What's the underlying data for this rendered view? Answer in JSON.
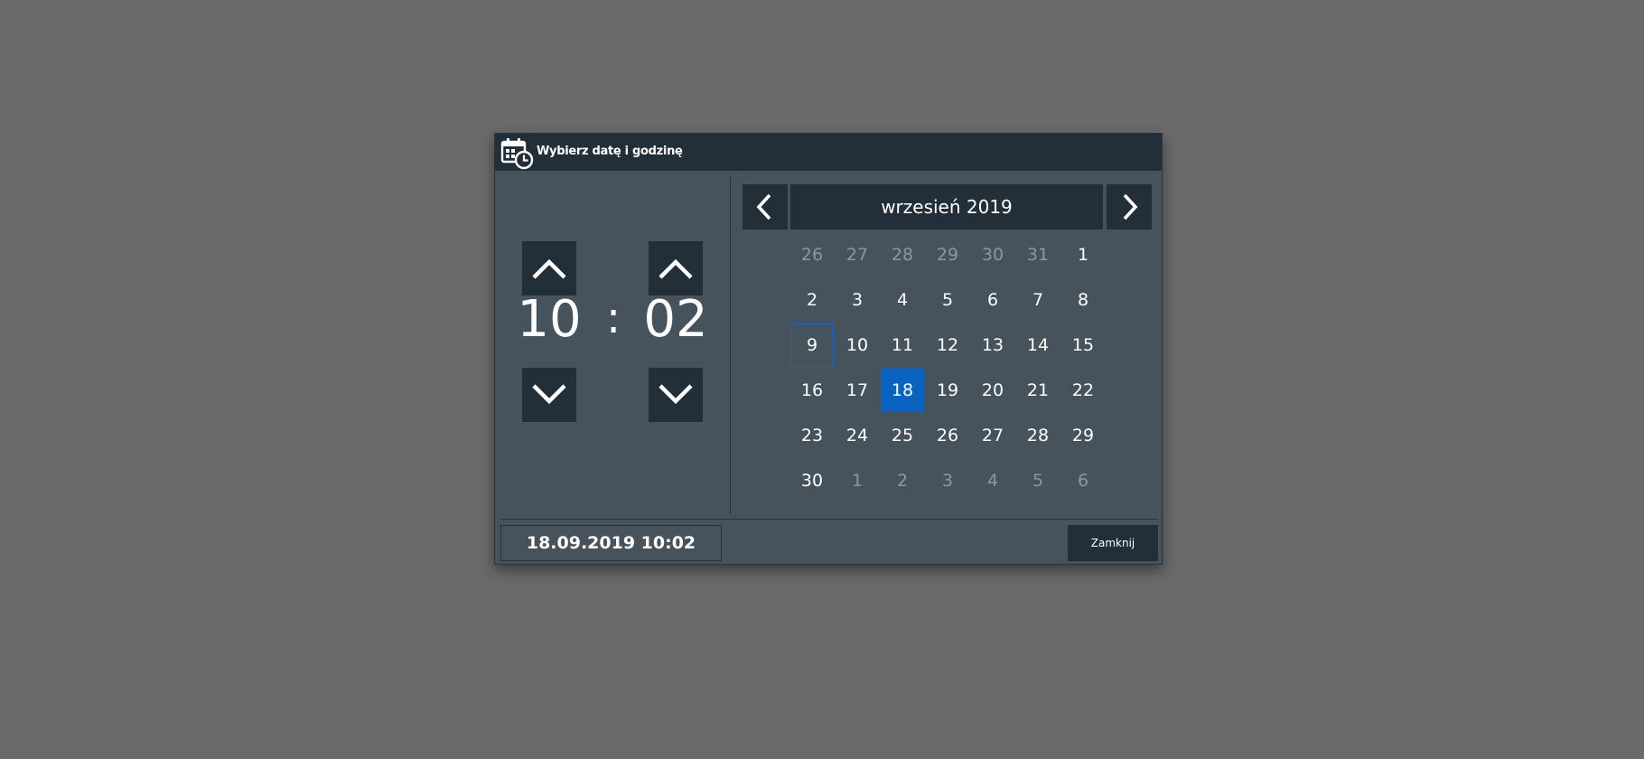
{
  "dialog": {
    "title": "Wybierz datę i godzinę",
    "title_icon": "calendar-clock-icon"
  },
  "time": {
    "hour": "10",
    "minute": "02",
    "separator": ":"
  },
  "calendar": {
    "month_label": "wrzesień 2019",
    "prev_icon": "chevron-left-icon",
    "next_icon": "chevron-right-icon",
    "weeks": [
      [
        {
          "d": "26",
          "other": true
        },
        {
          "d": "27",
          "other": true
        },
        {
          "d": "28",
          "other": true
        },
        {
          "d": "29",
          "other": true
        },
        {
          "d": "30",
          "other": true
        },
        {
          "d": "31",
          "other": true
        },
        {
          "d": "1"
        }
      ],
      [
        {
          "d": "2"
        },
        {
          "d": "3"
        },
        {
          "d": "4"
        },
        {
          "d": "5"
        },
        {
          "d": "6"
        },
        {
          "d": "7"
        },
        {
          "d": "8"
        }
      ],
      [
        {
          "d": "9",
          "today": true
        },
        {
          "d": "10"
        },
        {
          "d": "11"
        },
        {
          "d": "12"
        },
        {
          "d": "13"
        },
        {
          "d": "14"
        },
        {
          "d": "15"
        }
      ],
      [
        {
          "d": "16"
        },
        {
          "d": "17"
        },
        {
          "d": "18",
          "selected": true
        },
        {
          "d": "19"
        },
        {
          "d": "20"
        },
        {
          "d": "21"
        },
        {
          "d": "22"
        }
      ],
      [
        {
          "d": "23"
        },
        {
          "d": "24"
        },
        {
          "d": "25"
        },
        {
          "d": "26"
        },
        {
          "d": "27"
        },
        {
          "d": "28"
        },
        {
          "d": "29"
        }
      ],
      [
        {
          "d": "30"
        },
        {
          "d": "1",
          "other": true
        },
        {
          "d": "2",
          "other": true
        },
        {
          "d": "3",
          "other": true
        },
        {
          "d": "4",
          "other": true
        },
        {
          "d": "5",
          "other": true
        },
        {
          "d": "6",
          "other": true
        }
      ]
    ]
  },
  "footer": {
    "datetime": "18.09.2019 10:02",
    "close_label": "Zamknij"
  },
  "colors": {
    "background": "#6a6a6a",
    "dialog": "#46525c",
    "header": "#222e38",
    "selected": "#0a63c0",
    "today_border": "#1565c0"
  }
}
